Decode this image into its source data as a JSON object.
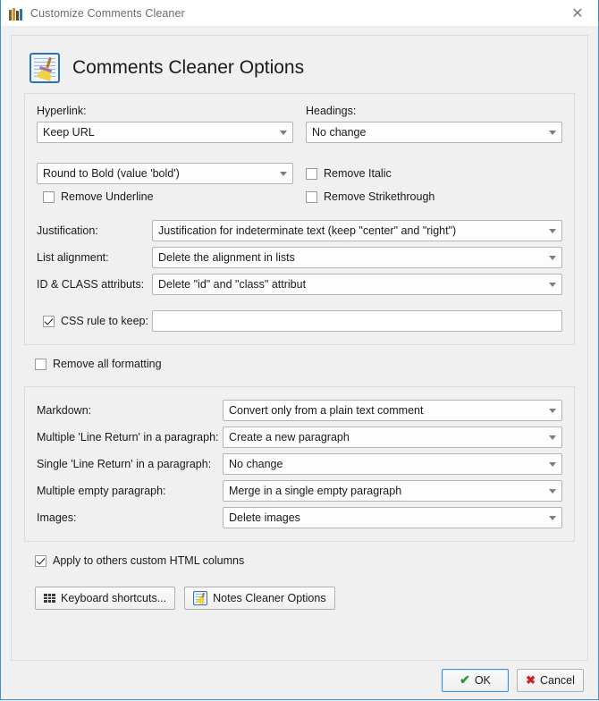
{
  "window": {
    "title": "Customize Comments Cleaner",
    "title_icon": "books-icon",
    "close_icon": "close-icon"
  },
  "header": {
    "title": "Comments Cleaner Options",
    "icon": "broom-notepad-icon"
  },
  "formatting_group": {
    "hyperlink": {
      "label": "Hyperlink:",
      "value": "Keep URL"
    },
    "headings": {
      "label": "Headings:",
      "value": "No change"
    },
    "bold": {
      "value": "Round to Bold (value 'bold')"
    },
    "remove_italic": {
      "label": "Remove Italic",
      "checked": false
    },
    "remove_underline": {
      "label": "Remove Underline",
      "checked": false
    },
    "remove_strikethrough": {
      "label": "Remove Strikethrough",
      "checked": false
    },
    "justification": {
      "label": "Justification:",
      "value": "Justification for indeterminate text (keep \"center\" and \"right\")"
    },
    "list_alignment": {
      "label": "List alignment:",
      "value": "Delete the alignment in lists"
    },
    "id_class": {
      "label": "ID & CLASS attributs:",
      "value": "Delete \"id\" and \"class\" attribut"
    },
    "css_rule": {
      "label": "CSS rule to keep:",
      "checked": true,
      "value": "",
      "placeholder": ""
    }
  },
  "remove_all_formatting": {
    "label": "Remove all formatting",
    "checked": false
  },
  "markdown_group": {
    "markdown": {
      "label": "Markdown:",
      "value": "Convert only from a plain text comment"
    },
    "multiple_line_return": {
      "label": "Multiple 'Line Return' in a paragraph:",
      "value": "Create a new paragraph"
    },
    "single_line_return": {
      "label": "Single 'Line Return' in a paragraph:",
      "value": "No change"
    },
    "multiple_empty_paragraph": {
      "label": "Multiple empty paragraph:",
      "value": "Merge in a single empty paragraph"
    },
    "images": {
      "label": "Images:",
      "value": "Delete images"
    }
  },
  "apply_others": {
    "label": "Apply to others custom HTML columns",
    "checked": true
  },
  "tool_buttons": {
    "keyboard_shortcuts": {
      "label": "Keyboard shortcuts...",
      "icon": "keyboard-grid-icon"
    },
    "notes_cleaner": {
      "label": "Notes Cleaner Options",
      "icon": "broom-notepad-icon"
    }
  },
  "footer": {
    "ok": "OK",
    "cancel": "Cancel",
    "ok_icon": "check-icon",
    "cancel_icon": "x-icon"
  },
  "colors": {
    "window_border": "#3f8fd2",
    "background": "#f0f0f0",
    "accent": "#2f6fb5",
    "ok_check": "#1f9d2f",
    "cancel_x": "#cc2222"
  }
}
